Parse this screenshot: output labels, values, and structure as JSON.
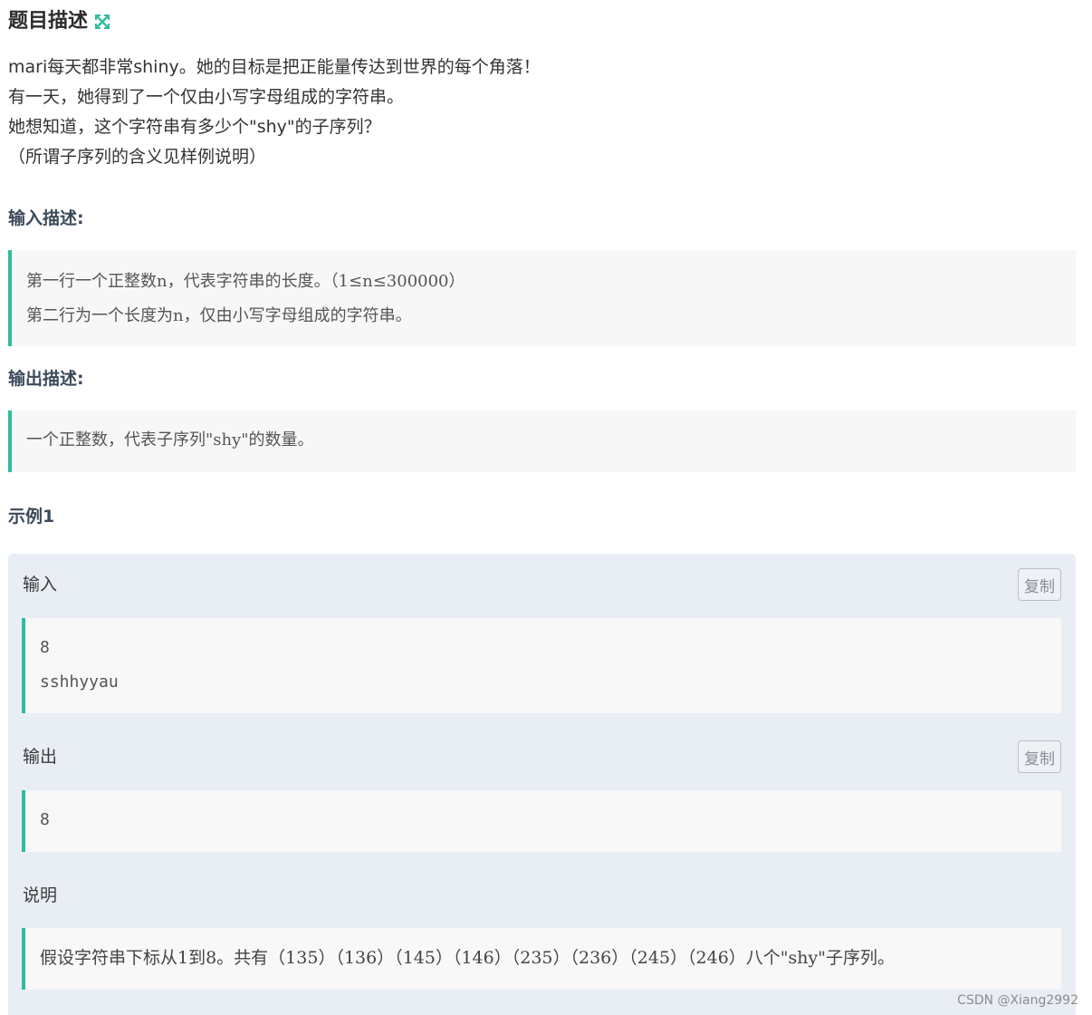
{
  "header": {
    "title": "题目描述",
    "expand_icon": "expand-arrows-icon"
  },
  "description": {
    "lines": [
      "mari每天都非常shiny。她的目标是把正能量传达到世界的每个角落！",
      "有一天，她得到了一个仅由小写字母组成的字符串。",
      "她想知道，这个字符串有多少个\"shy\"的子序列？",
      "（所谓子序列的含义见样例说明）"
    ]
  },
  "input_desc": {
    "label": "输入描述:",
    "lines": [
      "第一行一个正整数n，代表字符串的长度。（1≤n≤300000）",
      "第二行为一个长度为n，仅由小写字母组成的字符串。"
    ]
  },
  "output_desc": {
    "label": "输出描述:",
    "lines": [
      "一个正整数，代表子序列\"shy\"的数量。"
    ]
  },
  "example": {
    "heading": "示例1",
    "input_label": "输入",
    "input_lines": [
      "8",
      "sshhyyau"
    ],
    "output_label": "输出",
    "output_lines": [
      "8"
    ],
    "copy_label": "复制",
    "explain_label": "说明",
    "explain_text": "假设字符串下标从1到8。共有（135）（136）（145）（146）（235）（236）（245）（246）八个\"shy\"子序列。"
  },
  "watermark": "CSDN @Xiang2992",
  "colors": {
    "accent": "#2ebd9f",
    "panel_bg": "#e9eef5",
    "block_bg": "#f7f7f7"
  }
}
